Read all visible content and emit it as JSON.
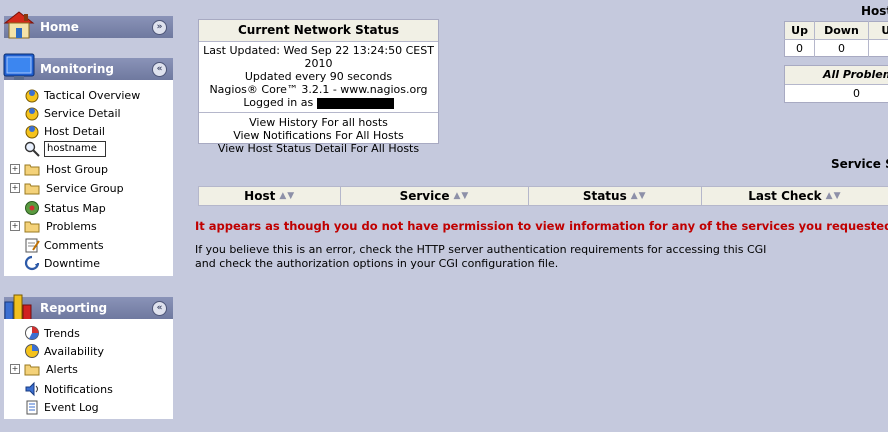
{
  "nav": {
    "home": {
      "title": "Home"
    },
    "monitoring": {
      "title": "Monitoring",
      "items": [
        {
          "label": "Tactical Overview"
        },
        {
          "label": "Service Detail"
        },
        {
          "label": "Host Detail"
        },
        {
          "label": "Host Group"
        },
        {
          "label": "Service Group"
        },
        {
          "label": "Status Map"
        },
        {
          "label": "Problems"
        },
        {
          "label": "Comments"
        },
        {
          "label": "Downtime"
        }
      ],
      "search_value": "hostname"
    },
    "reporting": {
      "title": "Reporting",
      "items": [
        {
          "label": "Trends"
        },
        {
          "label": "Availability"
        },
        {
          "label": "Alerts"
        },
        {
          "label": "Notifications"
        },
        {
          "label": "Event Log"
        }
      ]
    }
  },
  "status": {
    "title": "Current Network Status",
    "last_updated": "Last Updated: Wed Sep 22 13:24:50 CEST 2010",
    "interval": "Updated every 90 seconds",
    "version": "Nagios® Core™ 3.2.1 - www.nagios.org",
    "logged_in": "Logged in as",
    "links": [
      "View History For all hosts",
      "View Notifications For All Hosts",
      "View Host Status Detail For All Hosts"
    ]
  },
  "host_totals": {
    "title": "Host",
    "headers": [
      "Up",
      "Down",
      "U"
    ],
    "values": [
      "0",
      "0",
      ""
    ],
    "all_problems_label": "All Problems",
    "all_problems_value": "0"
  },
  "service_title": "Service St",
  "table": {
    "headers": [
      "Host",
      "Service",
      "Status",
      "Last Check"
    ]
  },
  "error": "It appears as though you do not have permission to view information for any of the services you requested...",
  "info": [
    "If you believe this is an error, check the HTTP server authentication requirements for accessing this CGI",
    "and check the authorization options in your CGI configuration file."
  ]
}
